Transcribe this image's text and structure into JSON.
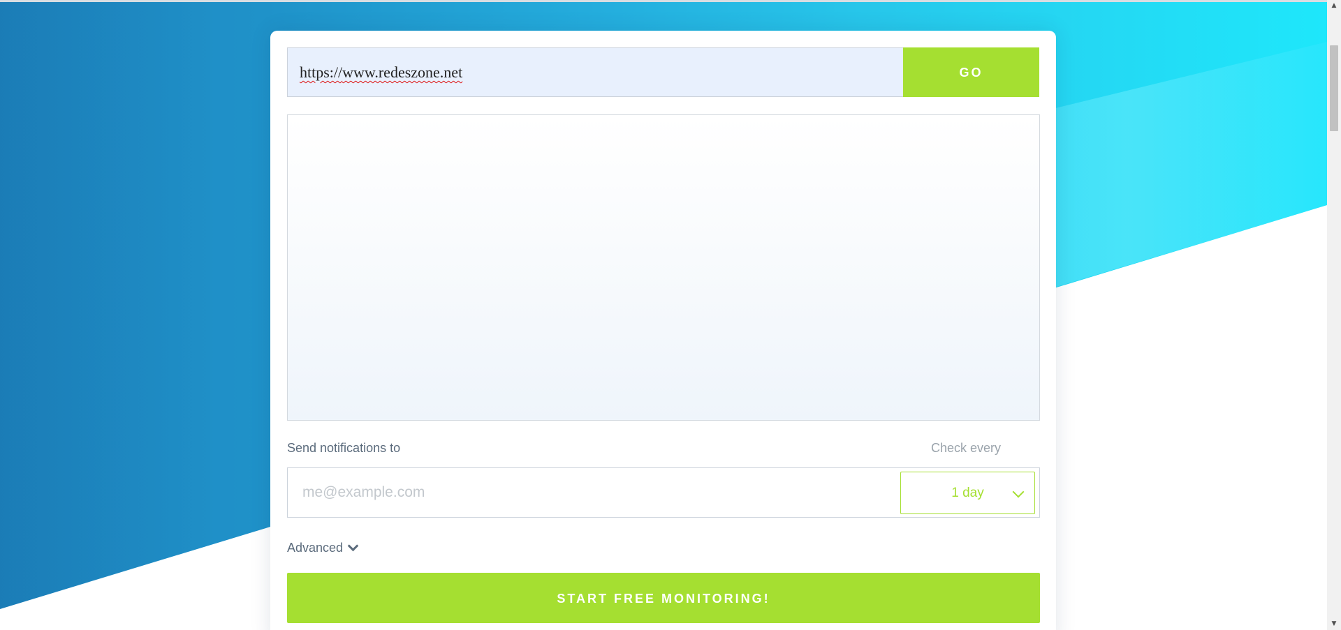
{
  "url_bar": {
    "value_prefix": "https://",
    "value_main": "www.redeszone.net",
    "go_label": "GO"
  },
  "notifications": {
    "send_label": "Send notifications to",
    "email_placeholder": "me@example.com",
    "check_label": "Check every",
    "interval_value": "1 day"
  },
  "advanced": {
    "label": "Advanced"
  },
  "start_button": {
    "label": "START FREE MONITORING!"
  },
  "colors": {
    "accent": "#a5df31",
    "url_bg": "#e8f0fd",
    "text_muted": "#5b6b7c"
  },
  "icons": {
    "interval": "chevron-down-icon",
    "advanced": "chevron-down-icon",
    "scroll_up": "scroll-up-arrow-icon",
    "scroll_down": "scroll-down-arrow-icon"
  }
}
